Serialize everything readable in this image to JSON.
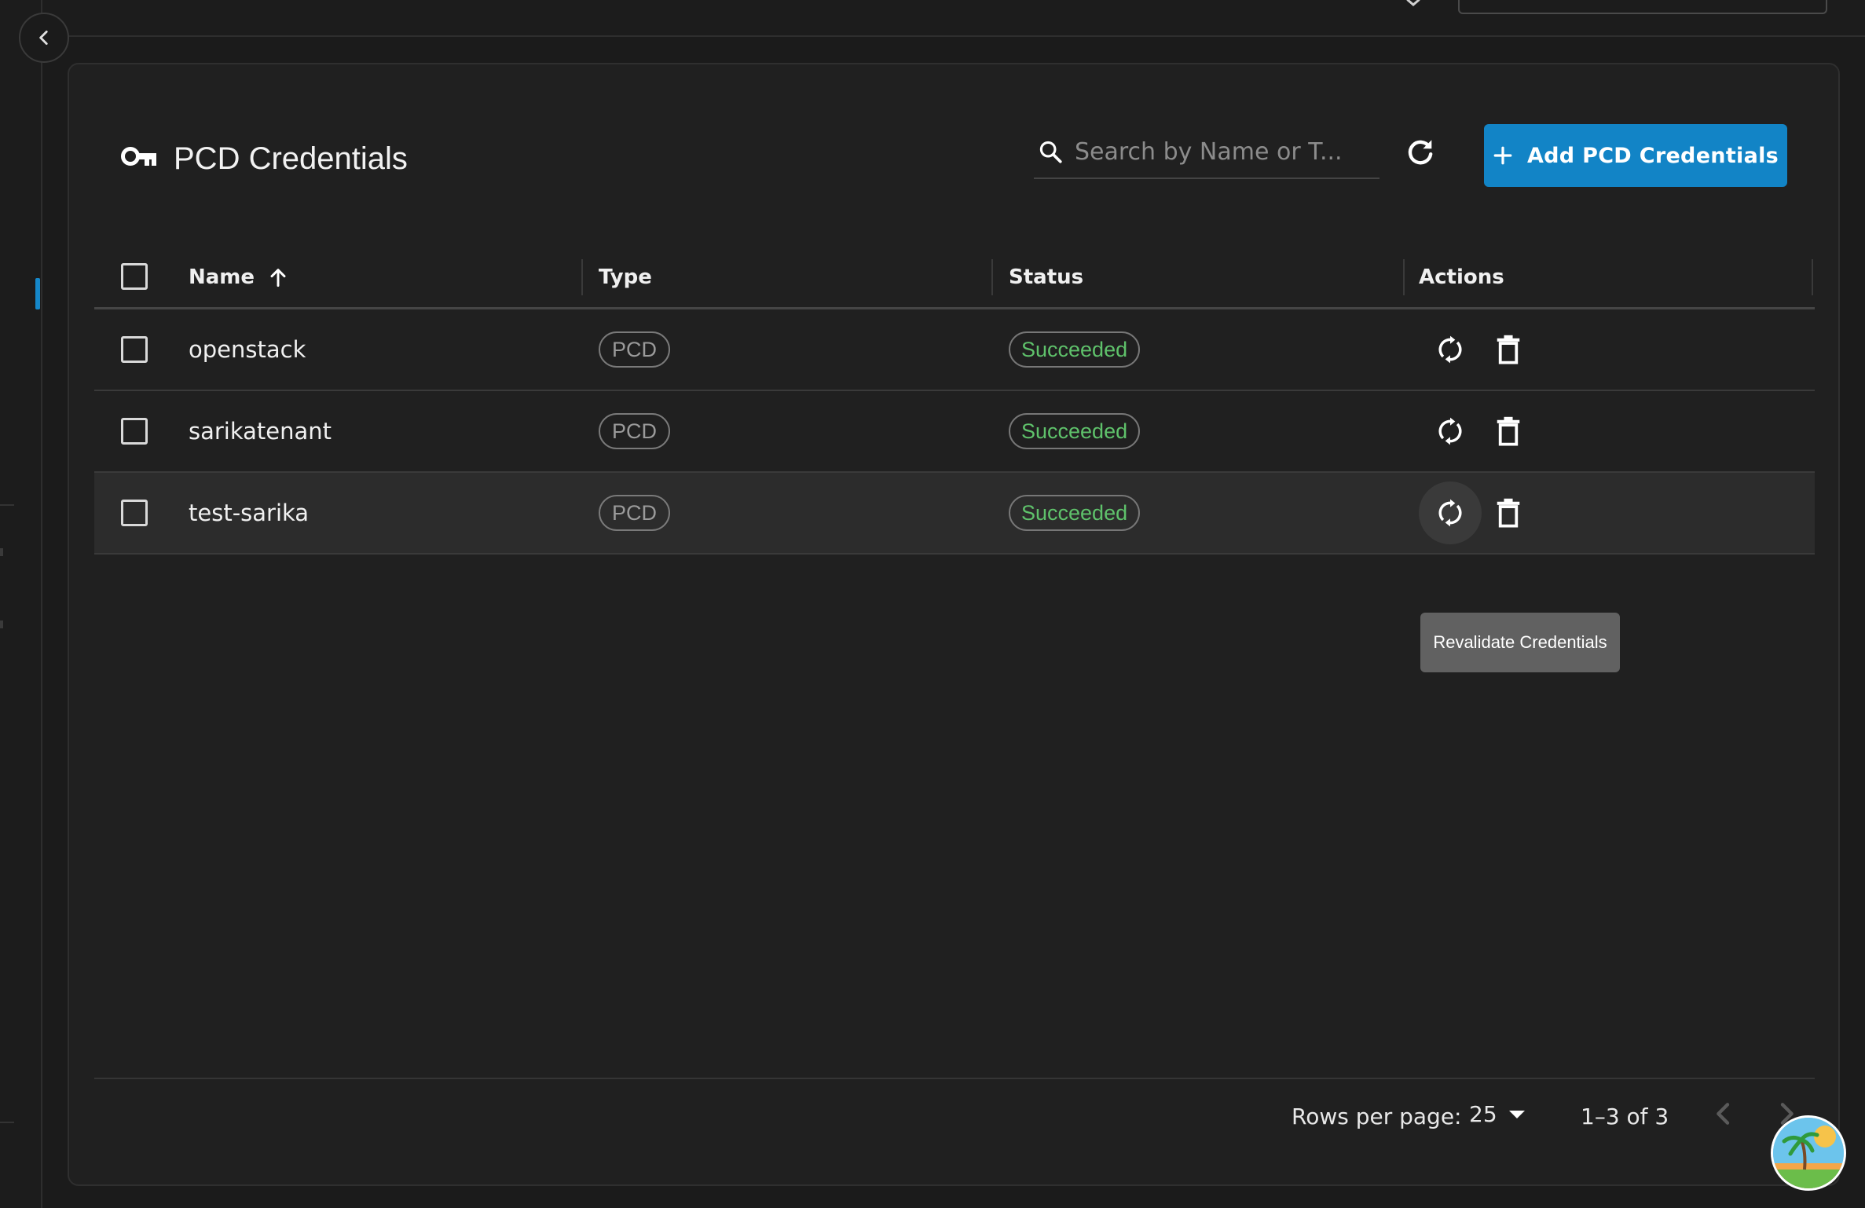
{
  "page": {
    "title": "PCD Credentials",
    "title_icon": "key-icon"
  },
  "toolbar": {
    "search_placeholder": "Search by Name or T...",
    "search_value": "",
    "refresh_icon": "refresh-icon",
    "add_label": "Add PCD Credentials",
    "add_icon": "plus-icon"
  },
  "table": {
    "columns": {
      "name": "Name",
      "type": "Type",
      "status": "Status",
      "actions": "Actions"
    },
    "sort": {
      "column": "Name",
      "direction": "ascending"
    },
    "rows": [
      {
        "name": "openstack",
        "type": "PCD",
        "status": "Succeeded"
      },
      {
        "name": "sarikatenant",
        "type": "PCD",
        "status": "Succeeded"
      },
      {
        "name": "test-sarika",
        "type": "PCD",
        "status": "Succeeded"
      }
    ],
    "hovered_row": 2
  },
  "tooltip": {
    "text": "Revalidate Credentials"
  },
  "pagination": {
    "rows_per_page_label": "Rows per page:",
    "rows_per_page_value": "25",
    "range_text": "1–3 of 3"
  },
  "colors": {
    "accent": "#1284c6",
    "status_success": "#5fc26b",
    "background": "#1b1b1b",
    "card": "#202020"
  }
}
